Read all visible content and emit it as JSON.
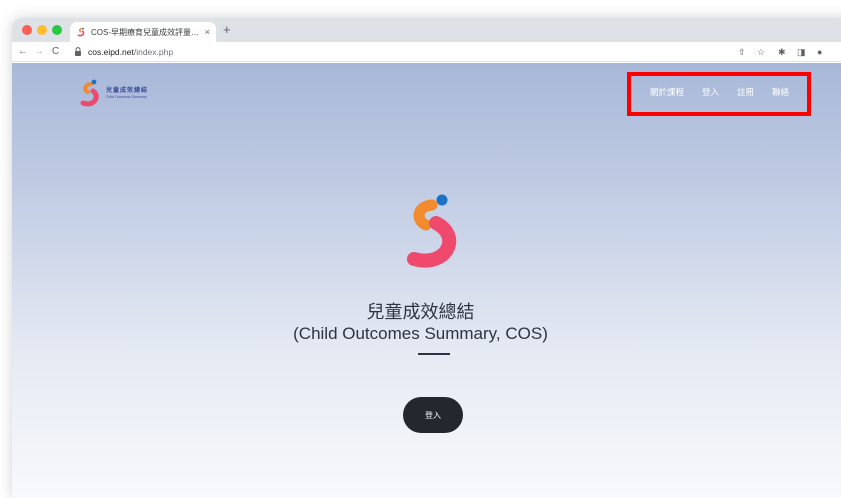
{
  "browser": {
    "tab_title": "COS-早期療育兒童成效評量總結",
    "tab_close": "×",
    "new_tab": "+",
    "url_host": "cos.eipd.net",
    "url_path": "/index.php",
    "icons": {
      "back": "←",
      "forward": "→",
      "reload": "C",
      "share": "⇧",
      "bookmark": "☆",
      "extensions": "✱",
      "sidebar": "◨",
      "profile": "●"
    }
  },
  "site": {
    "logo_zh": "兒童成效總結",
    "logo_en": "Child Outcomes Summary",
    "nav": [
      "關於課程",
      "登入",
      "註冊",
      "聯絡"
    ]
  },
  "hero": {
    "title_zh": "兒童成效總結",
    "title_en": "(Child Outcomes Summary, COS)",
    "login_label": "登入"
  },
  "colors": {
    "highlight": "#ff0000",
    "button": "#23272e",
    "logo_orange": "#f28a2e",
    "logo_pink": "#ef4a6e",
    "logo_blue": "#1d72c4"
  }
}
